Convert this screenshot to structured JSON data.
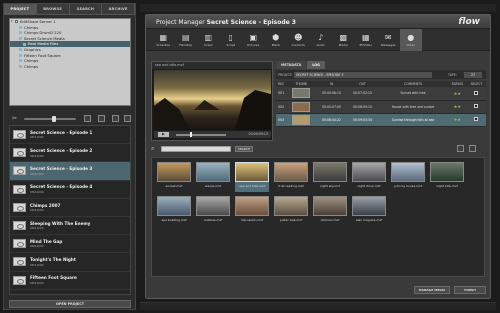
{
  "left": {
    "tabs": [
      "PROJECT",
      "BROWSE",
      "SEARCH",
      "ARCHIVE"
    ],
    "tree": [
      {
        "label": "EditShare Server 1",
        "kind": "proj",
        "indent": 0
      },
      {
        "label": "Chimps",
        "kind": "folder",
        "indent": 1
      },
      {
        "label": "Chimps DrumD 220",
        "kind": "folder",
        "indent": 1
      },
      {
        "label": "Secret Science Media",
        "kind": "folder",
        "indent": 1
      },
      {
        "label": "Real Media Files",
        "kind": "folder",
        "indent": 2,
        "selected": true
      },
      {
        "label": "Graphics",
        "kind": "folder",
        "indent": 1
      },
      {
        "label": "Fifteen Foot Square",
        "kind": "folder",
        "indent": 1
      },
      {
        "label": "Chimps",
        "kind": "folder",
        "indent": 1
      },
      {
        "label": "Chimps",
        "kind": "folder",
        "indent": 1
      }
    ],
    "projects": [
      {
        "name": "Secret Science - Episode 1",
        "date": "08/10/09"
      },
      {
        "name": "Secret Science - Episode 2",
        "date": "08/10/09"
      },
      {
        "name": "Secret Science - Episode 3",
        "date": "08/10/09",
        "selected": true
      },
      {
        "name": "Secret Science - Episode 4",
        "date": "08/10/09"
      },
      {
        "name": "Chimps 2007",
        "date": "08/10/09"
      },
      {
        "name": "Sleeping With The Enemy",
        "date": "08/10/09"
      },
      {
        "name": "Mind The Gap",
        "date": "08/10/09"
      },
      {
        "name": "Tonight's The Night",
        "date": "08/10/09"
      },
      {
        "name": "Fifteen Foot Square",
        "date": "08/10/09"
      }
    ],
    "open_project_label": "OPEN PROJECT"
  },
  "main": {
    "title_prefix": "Project Manager",
    "title_project": "Secret Science - Episode 3",
    "brand": "flow",
    "icons": [
      {
        "label": "Schedule",
        "icon": "calendar-icon",
        "glyph": "▦"
      },
      {
        "label": "Filmstrip",
        "icon": "filmstrip-icon",
        "glyph": "▤"
      },
      {
        "label": "Crawl",
        "icon": "crawl-icon",
        "glyph": "▥"
      },
      {
        "label": "Script",
        "icon": "script-icon",
        "glyph": "▯"
      },
      {
        "label": "Pictures",
        "icon": "pictures-icon",
        "glyph": "▣"
      },
      {
        "label": "Black",
        "icon": "black-icon",
        "glyph": "⬢"
      },
      {
        "label": "Contacts",
        "icon": "contacts-icon",
        "glyph": "☻"
      },
      {
        "label": "Audio",
        "icon": "audio-icon",
        "glyph": "♪"
      },
      {
        "label": "Media",
        "icon": "media-icon",
        "glyph": "▩"
      },
      {
        "label": "EDVideo",
        "icon": "edvideo-icon",
        "glyph": "▦"
      },
      {
        "label": "Messages",
        "icon": "messages-icon",
        "glyph": "✉"
      },
      {
        "label": "Video",
        "icon": "video-camera-icon",
        "glyph": "●",
        "active": true
      }
    ],
    "viewer": {
      "filename": "sea and bills.mxf",
      "play_label": "▶",
      "timecode": "00:00:09:13"
    },
    "tabs": [
      "METADATA",
      "LOG"
    ],
    "active_tab": "LOG",
    "project_label": "PROJECT:",
    "project_value": "SECRET SCIENCE - EPISODE 3",
    "tape_label": "TAPE:",
    "tape_value": "27",
    "columns": [
      "REC",
      "THUMB",
      "IN",
      "OUT",
      "COMMENTS",
      "RATING",
      "SELECT"
    ],
    "rows": [
      {
        "rec": "001",
        "thumb_color": "#777a6a",
        "in": "00:00:06:14",
        "out": "00:07:02:15",
        "comment": "Sunset with tree",
        "rating": "★★",
        "selected": false
      },
      {
        "rec": "002",
        "thumb_color": "#8a6b4a",
        "in": "00:00:07:09",
        "out": "00:08:09:10",
        "comment": "House with tree and sunset",
        "rating": "★★",
        "selected": false
      },
      {
        "rec": "003",
        "thumb_color": "#b59a6a",
        "in": "00:08:44:22",
        "out": "00:09:03:34",
        "comment": "Sunrise through hills at sea",
        "rating": "★★",
        "selected": true
      }
    ],
    "search": {
      "placeholder": "",
      "button_label": "SEARCH"
    },
    "media": [
      {
        "label": "sunset.mxf",
        "c1": "#5a4d38",
        "c2": "#c59a5a"
      },
      {
        "label": "waves.mxf",
        "c1": "#506a7a",
        "c2": "#9ab3c2"
      },
      {
        "label": "sea and hills.mxf",
        "c1": "#6b5a3a",
        "c2": "#e0c27a",
        "selected": true
      },
      {
        "label": "fruit reading.mxf",
        "c1": "#6a5a4a",
        "c2": "#c9a27a"
      },
      {
        "label": "night sky.mxf",
        "c1": "#3a3a3a",
        "c2": "#7a7a6a"
      },
      {
        "label": "night drive.mxf",
        "c1": "#4a4a50",
        "c2": "#a8a8a8"
      },
      {
        "label": "john by house.mxf",
        "c1": "#5a6a7a",
        "c2": "#b0c0d0"
      },
      {
        "label": "night kids.mxf",
        "c1": "#2a3a2a",
        "c2": "#6a7a6a"
      },
      {
        "label": "apa building.mxf",
        "c1": "#4a5a6a",
        "c2": "#9ab0c0"
      },
      {
        "label": "mobiles.mxf",
        "c1": "#4a4a4a",
        "c2": "#aaaaaa"
      },
      {
        "label": "discussion.mxf",
        "c1": "#6a5040",
        "c2": "#c0a080"
      },
      {
        "label": "public talk.mxf",
        "c1": "#5a5040",
        "c2": "#b8a890"
      },
      {
        "label": "dollman.mxf",
        "c1": "#4a4038",
        "c2": "#a09080"
      },
      {
        "label": "alan maguire.mxf",
        "c1": "#3a4048",
        "c2": "#98a0a8"
      }
    ],
    "manage_media_label": "MANAGE MEDIA",
    "finish_label": "FINISH"
  }
}
